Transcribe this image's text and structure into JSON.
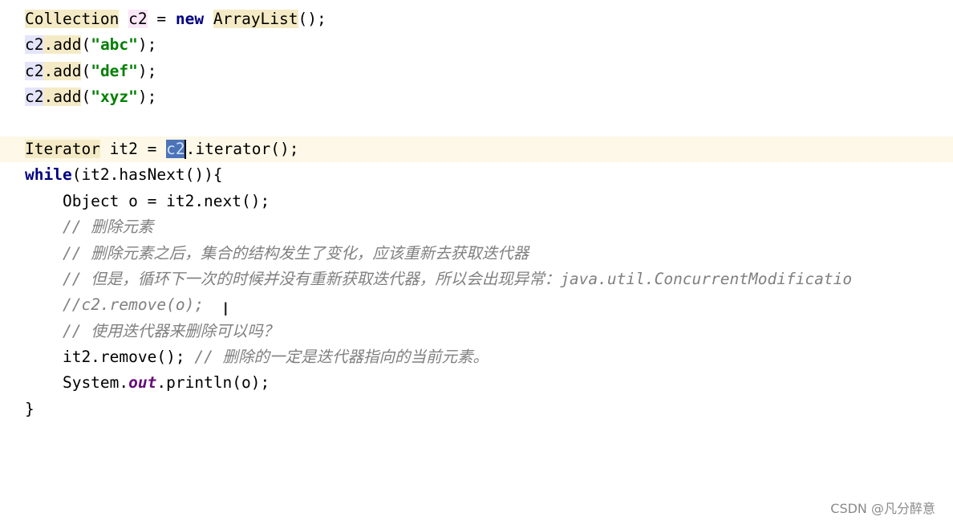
{
  "editor": {
    "lines": [
      [
        {
          "t": "Collection",
          "c": "hl-type"
        },
        {
          "t": " "
        },
        {
          "t": "c2",
          "c": "hl-var"
        },
        {
          "t": " = "
        },
        {
          "t": "new",
          "c": "kw"
        },
        {
          "t": " "
        },
        {
          "t": "ArrayList",
          "c": "hl-type"
        },
        {
          "t": "();"
        }
      ],
      [
        {
          "t": "c2",
          "c": "hl-ref"
        },
        {
          "t": ".add",
          "c": "hl-meth"
        },
        {
          "t": "("
        },
        {
          "t": "\"abc\"",
          "c": "str"
        },
        {
          "t": ");"
        }
      ],
      [
        {
          "t": "c2",
          "c": "hl-ref"
        },
        {
          "t": ".add",
          "c": "hl-meth"
        },
        {
          "t": "("
        },
        {
          "t": "\"def\"",
          "c": "str"
        },
        {
          "t": ");"
        }
      ],
      [
        {
          "t": "c2",
          "c": "hl-ref"
        },
        {
          "t": ".add",
          "c": "hl-meth"
        },
        {
          "t": "("
        },
        {
          "t": "\"xyz\"",
          "c": "str"
        },
        {
          "t": ");"
        }
      ],
      [],
      [
        {
          "t": "Iterator",
          "c": "hl-type"
        },
        {
          "t": " it2 = "
        },
        {
          "t": "c2",
          "c": "sel"
        },
        {
          "t": "",
          "c": "caret"
        },
        {
          "t": ".iterator();"
        }
      ],
      [
        {
          "t": "while",
          "c": "kw"
        },
        {
          "t": "(it2.hasNext()){"
        }
      ],
      [
        {
          "t": "    Object o = it2.next();"
        }
      ],
      [
        {
          "t": "    "
        },
        {
          "t": "// 删除元素",
          "c": "cm"
        }
      ],
      [
        {
          "t": "    "
        },
        {
          "t": "// 删除元素之后，集合的结构发生了变化，应该重新去获取迭代器",
          "c": "cm"
        }
      ],
      [
        {
          "t": "    "
        },
        {
          "t": "// 但是，循环下一次的时候并没有重新获取迭代器，所以会出现异常：java.util.ConcurrentModificatio",
          "c": "cm"
        }
      ],
      [
        {
          "t": "    "
        },
        {
          "t": "//c2.remove(o);",
          "c": "cm"
        }
      ],
      [
        {
          "t": "    "
        },
        {
          "t": "// 使用迭代器来删除可以吗？",
          "c": "cm"
        }
      ],
      [
        {
          "t": "    it2.remove(); "
        },
        {
          "t": "// 删除的一定是迭代器指向的当前元素。",
          "c": "cm"
        }
      ],
      [
        {
          "t": "    System."
        },
        {
          "t": "out",
          "c": "fld"
        },
        {
          "t": ".println(o);"
        }
      ],
      [
        {
          "t": "}"
        }
      ]
    ],
    "current_line": 5
  },
  "cursor_icon": "text-ibeam-icon",
  "watermark": "CSDN @凡分醉意"
}
